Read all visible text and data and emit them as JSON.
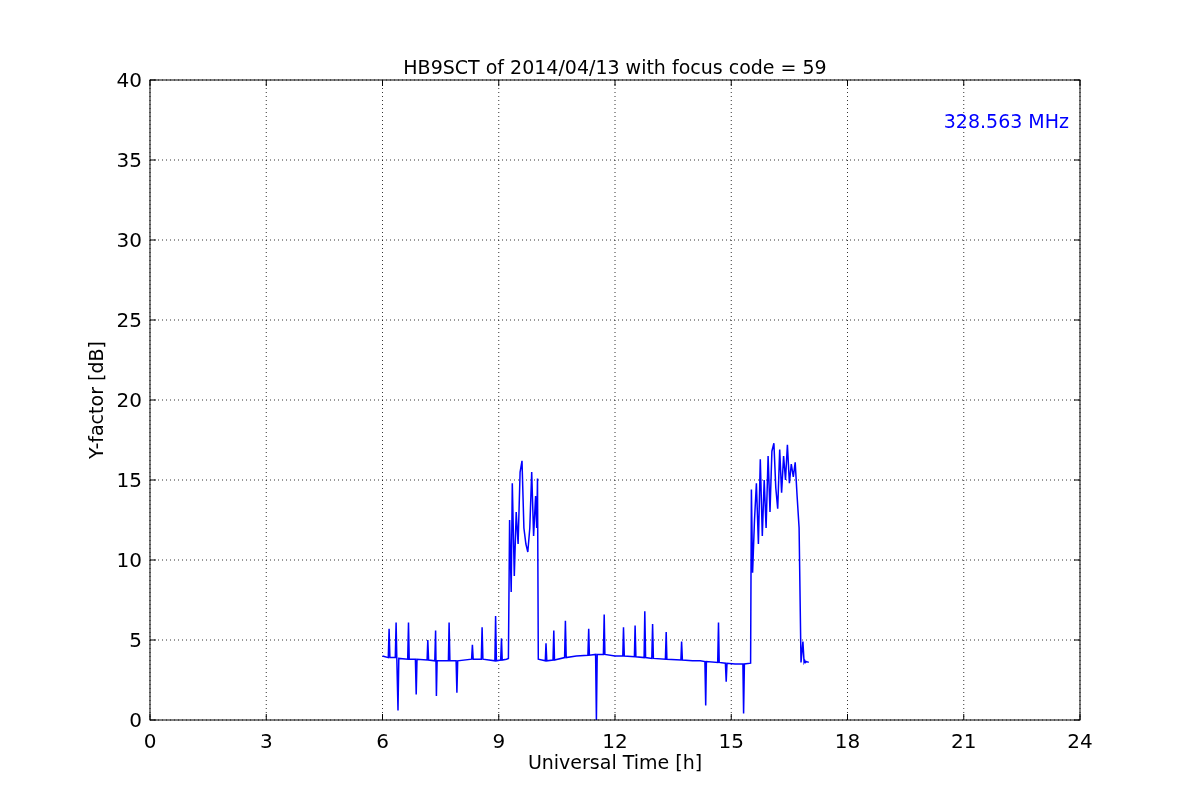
{
  "figure": {
    "chart_data": {
      "type": "line",
      "title": "HB9SCT of 2014/04/13 with focus code = 59",
      "xlabel": "Universal Time [h]",
      "ylabel": "Y-factor [dB]",
      "x": [
        6.0,
        6.15,
        6.17,
        6.19,
        6.33,
        6.35,
        6.37,
        6.4,
        6.42,
        6.65,
        6.67,
        6.69,
        6.85,
        6.87,
        6.89,
        7.15,
        7.17,
        7.19,
        7.35,
        7.37,
        7.39,
        7.41,
        7.7,
        7.72,
        7.74,
        7.9,
        7.92,
        7.94,
        8.3,
        8.32,
        8.34,
        8.55,
        8.57,
        8.59,
        8.9,
        8.92,
        8.94,
        9.05,
        9.07,
        9.09,
        9.2,
        9.25,
        9.28,
        9.32,
        9.35,
        9.4,
        9.45,
        9.5,
        9.55,
        9.6,
        9.65,
        9.7,
        9.75,
        9.8,
        9.85,
        9.9,
        9.95,
        9.98,
        10.0,
        10.02,
        10.2,
        10.22,
        10.24,
        10.4,
        10.42,
        10.44,
        10.7,
        10.72,
        10.74,
        11.0,
        11.3,
        11.32,
        11.34,
        11.5,
        11.52,
        11.54,
        11.7,
        11.72,
        11.74,
        12.0,
        12.2,
        12.22,
        12.24,
        12.5,
        12.52,
        12.54,
        12.75,
        12.77,
        12.79,
        12.95,
        12.97,
        12.99,
        13.3,
        13.32,
        13.34,
        13.7,
        13.72,
        13.74,
        14.0,
        14.2,
        14.32,
        14.34,
        14.36,
        14.65,
        14.67,
        14.69,
        14.85,
        14.87,
        14.89,
        15.1,
        15.3,
        15.32,
        15.34,
        15.5,
        15.52,
        15.55,
        15.6,
        15.65,
        15.7,
        15.75,
        15.8,
        15.85,
        15.9,
        15.95,
        16.0,
        16.05,
        16.1,
        16.15,
        16.2,
        16.25,
        16.3,
        16.35,
        16.4,
        16.45,
        16.5,
        16.55,
        16.6,
        16.65,
        16.7,
        16.75,
        16.8,
        16.85,
        16.88,
        16.9,
        16.92,
        16.94,
        17.0
      ],
      "series": [
        {
          "name": "328.563 MHz",
          "color": "#0000ff",
          "values": [
            4.0,
            3.9,
            5.7,
            3.9,
            3.9,
            6.1,
            3.9,
            0.6,
            3.85,
            3.8,
            6.1,
            3.8,
            3.8,
            1.6,
            3.8,
            3.75,
            5.0,
            3.75,
            3.7,
            5.6,
            1.5,
            3.7,
            3.7,
            6.1,
            3.7,
            3.7,
            1.7,
            3.7,
            3.8,
            4.7,
            3.8,
            3.8,
            5.8,
            3.8,
            3.7,
            6.5,
            3.7,
            3.75,
            5.1,
            3.75,
            3.8,
            3.85,
            12.5,
            8.0,
            14.8,
            9.0,
            13.0,
            11.0,
            15.5,
            16.2,
            12.0,
            11.0,
            10.5,
            12.0,
            15.5,
            11.5,
            14.0,
            12.0,
            15.1,
            3.8,
            3.7,
            4.8,
            3.7,
            3.75,
            5.6,
            3.75,
            3.9,
            6.2,
            3.9,
            4.0,
            4.05,
            5.7,
            4.05,
            4.1,
            0.0,
            4.1,
            4.1,
            6.6,
            4.1,
            4.0,
            4.0,
            5.8,
            4.0,
            3.95,
            5.9,
            3.95,
            3.9,
            6.8,
            3.9,
            3.85,
            6.0,
            3.85,
            3.8,
            5.5,
            3.8,
            3.75,
            4.9,
            3.75,
            3.7,
            3.7,
            3.65,
            0.9,
            3.65,
            3.6,
            6.1,
            3.6,
            3.55,
            2.4,
            3.55,
            3.5,
            3.5,
            0.4,
            3.5,
            3.55,
            14.4,
            9.2,
            12.5,
            14.8,
            11.0,
            16.3,
            11.5,
            15.0,
            12.0,
            16.5,
            13.0,
            16.8,
            17.3,
            14.5,
            13.2,
            16.9,
            14.2,
            16.5,
            15.0,
            17.2,
            14.8,
            16.0,
            15.2,
            16.1,
            14.0,
            12.0,
            3.6,
            4.9,
            3.6,
            3.7,
            3.6,
            3.65,
            3.6
          ]
        }
      ],
      "xlim": [
        0,
        24
      ],
      "ylim": [
        0,
        40
      ],
      "xticks": [
        0,
        3,
        6,
        9,
        12,
        15,
        18,
        21,
        24
      ],
      "yticks": [
        0,
        5,
        10,
        15,
        20,
        25,
        30,
        35,
        40
      ],
      "grid": true
    }
  }
}
